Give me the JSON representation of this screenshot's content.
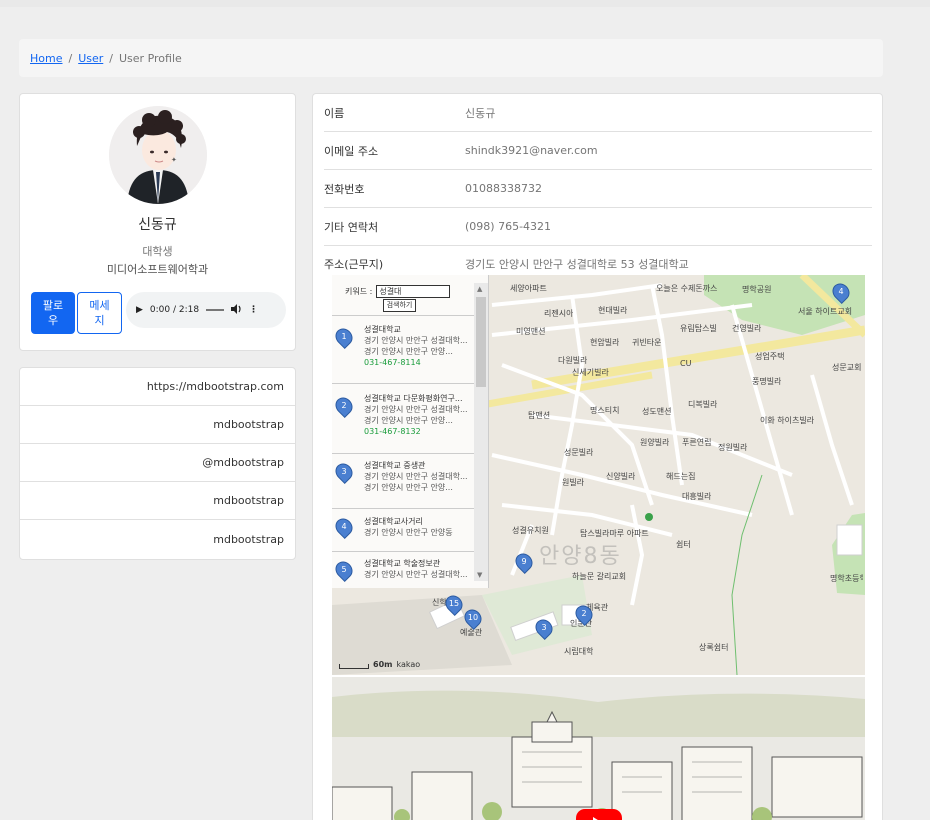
{
  "breadcrumb": {
    "home": "Home",
    "user": "User",
    "current": "User Profile"
  },
  "profile": {
    "name": "신동규",
    "role": "대학생",
    "department": "미디어소프트웨어학과",
    "follow_label": "팔로우",
    "message_label": "메세지",
    "audio_time": "0:00 / 2:18"
  },
  "links": [
    "https://mdbootstrap.com",
    "mdbootstrap",
    "@mdbootstrap",
    "mdbootstrap",
    "mdbootstrap"
  ],
  "info": {
    "rows": [
      {
        "label": "이름",
        "value": "신동규"
      },
      {
        "label": "이메일 주소",
        "value": "shindk3921@naver.com"
      },
      {
        "label": "전화번호",
        "value": "01088338732"
      },
      {
        "label": "기타 연락처",
        "value": "(098) 765-4321"
      },
      {
        "label": "주소(근무지)",
        "value": "경기도 안양시 만안구 성결대학로 53 성결대학교"
      }
    ]
  },
  "map": {
    "keyword_label": "키워드 :",
    "keyword_value": "성결대",
    "search_button": "검색하기",
    "places": [
      {
        "num": "1",
        "title": "성결대학교",
        "addr1": "경기 안양시 만안구 성결대학...",
        "addr2": "경기 안양시 만안구 안양...",
        "phone": "031-467-8114"
      },
      {
        "num": "2",
        "title": "성결대학교 다문화평화연구...",
        "addr1": "경기 안양시 만안구 성결대학...",
        "addr2": "경기 안양시 만안구 안양...",
        "phone": "031-467-8132"
      },
      {
        "num": "3",
        "title": "성결대학교 중생관",
        "addr1": "경기 안양시 만안구 성결대학...",
        "addr2": "경기 안양시 만안구 안양...",
        "phone": ""
      },
      {
        "num": "4",
        "title": "성결대학교사거리",
        "addr1": "경기 안양시 만안구 안양동",
        "addr2": "",
        "phone": ""
      },
      {
        "num": "5",
        "title": "성결대학교 학술정보관",
        "addr1": "경기 안양시 만안구 성결대학...",
        "addr2": "",
        "phone": ""
      }
    ],
    "dong_label": "안양8동",
    "scale_label": "60m",
    "provider": "kakao",
    "labels": [
      {
        "text": "세양아파트"
      },
      {
        "text": "리젠시아"
      },
      {
        "text": "현대빌라"
      },
      {
        "text": "오늘은 수제돈까스"
      },
      {
        "text": "명학공원"
      },
      {
        "text": "미영맨션"
      },
      {
        "text": "현암빌라"
      },
      {
        "text": "귀빈타운"
      },
      {
        "text": "유림탑스빌"
      },
      {
        "text": "건영빌라"
      },
      {
        "text": "서울 하이트교회"
      },
      {
        "text": "다원빌라"
      },
      {
        "text": "신세기빌라"
      },
      {
        "text": "CU"
      },
      {
        "text": "성업주택"
      },
      {
        "text": "성문교회"
      },
      {
        "text": "풍명빌라"
      },
      {
        "text": "탑맨션"
      },
      {
        "text": "명스티치"
      },
      {
        "text": "성도맨션"
      },
      {
        "text": "디복빌라"
      },
      {
        "text": "이화 하이츠빌라"
      },
      {
        "text": "원양빌라"
      },
      {
        "text": "푸른연립"
      },
      {
        "text": "정원빌라"
      },
      {
        "text": "성문빌라"
      },
      {
        "text": "원빌라"
      },
      {
        "text": "신양빌라"
      },
      {
        "text": "해드는집"
      },
      {
        "text": "대흥빌라"
      },
      {
        "text": "탑스빌라마루 아파트"
      },
      {
        "text": "쉼터"
      },
      {
        "text": "성결유치원"
      },
      {
        "text": "하늘문 갈리교회"
      },
      {
        "text": "명학초등학교"
      },
      {
        "text": "체육관"
      },
      {
        "text": "인문관"
      },
      {
        "text": "예술관"
      },
      {
        "text": "시립대학"
      },
      {
        "text": "상록쉼터"
      },
      {
        "text": "신학관"
      }
    ],
    "pins": [
      "4",
      "9",
      "15",
      "10",
      "2",
      "3"
    ]
  }
}
